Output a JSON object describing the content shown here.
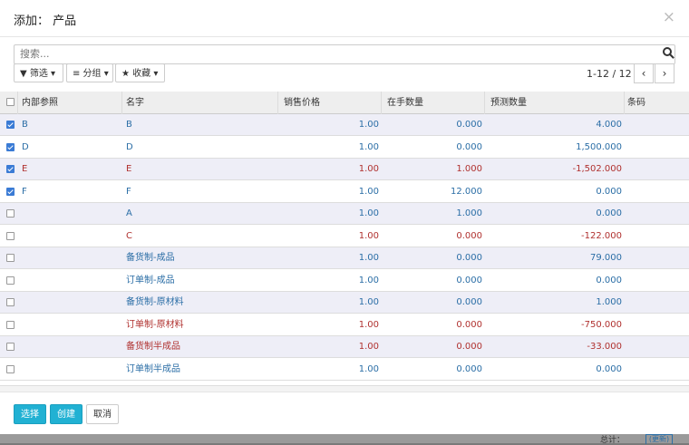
{
  "dialog": {
    "title": "添加： 产品",
    "close_glyph": "×"
  },
  "search": {
    "placeholder": "搜索..."
  },
  "toolbar": {
    "filter": "▼ 筛选 ▾",
    "group": "≡ 分组 ▾",
    "favorites": "★ 收藏 ▾"
  },
  "pager": {
    "text": "1-12 / 12",
    "prev": "‹",
    "next": "›"
  },
  "columns": {
    "ref": "内部参照",
    "name": "名字",
    "price": "销售价格",
    "onhand": "在手数量",
    "forecast": "预测数量",
    "barcode": "条码"
  },
  "rows": [
    {
      "checked": true,
      "ref": "B",
      "name": "B",
      "price": "1.00",
      "onhand": "0.000",
      "forecast": "4.000",
      "tone": "blue"
    },
    {
      "checked": true,
      "ref": "D",
      "name": "D",
      "price": "1.00",
      "onhand": "0.000",
      "forecast": "1,500.000",
      "tone": "blue"
    },
    {
      "checked": true,
      "ref": "E",
      "name": "E",
      "price": "1.00",
      "onhand": "1.000",
      "forecast": "-1,502.000",
      "tone": "red"
    },
    {
      "checked": true,
      "ref": "F",
      "name": "F",
      "price": "1.00",
      "onhand": "12.000",
      "forecast": "0.000",
      "tone": "blue"
    },
    {
      "checked": false,
      "ref": "",
      "name": "A",
      "price": "1.00",
      "onhand": "1.000",
      "forecast": "0.000",
      "tone": "blue"
    },
    {
      "checked": false,
      "ref": "",
      "name": "C",
      "price": "1.00",
      "onhand": "0.000",
      "forecast": "-122.000",
      "tone": "red"
    },
    {
      "checked": false,
      "ref": "",
      "name": "备货制-成品",
      "price": "1.00",
      "onhand": "0.000",
      "forecast": "79.000",
      "tone": "blue"
    },
    {
      "checked": false,
      "ref": "",
      "name": "订单制-成品",
      "price": "1.00",
      "onhand": "0.000",
      "forecast": "0.000",
      "tone": "blue"
    },
    {
      "checked": false,
      "ref": "",
      "name": "备货制-原材料",
      "price": "1.00",
      "onhand": "0.000",
      "forecast": "1.000",
      "tone": "blue"
    },
    {
      "checked": false,
      "ref": "",
      "name": "订单制-原材料",
      "price": "1.00",
      "onhand": "0.000",
      "forecast": "-750.000",
      "tone": "red"
    },
    {
      "checked": false,
      "ref": "",
      "name": "备货制半成品",
      "price": "1.00",
      "onhand": "0.000",
      "forecast": "-33.000",
      "tone": "red"
    },
    {
      "checked": false,
      "ref": "",
      "name": "订单制半成品",
      "price": "1.00",
      "onhand": "0.000",
      "forecast": "0.000",
      "tone": "blue"
    }
  ],
  "footer": {
    "select": "选择",
    "create": "创建",
    "cancel": "取消"
  },
  "background": {
    "total_label": "总计：",
    "update_label": "(更新)"
  },
  "colors": {
    "primary": "#21b1d3",
    "link_blue": "#2b6ea6",
    "negative_red": "#b0312f"
  }
}
